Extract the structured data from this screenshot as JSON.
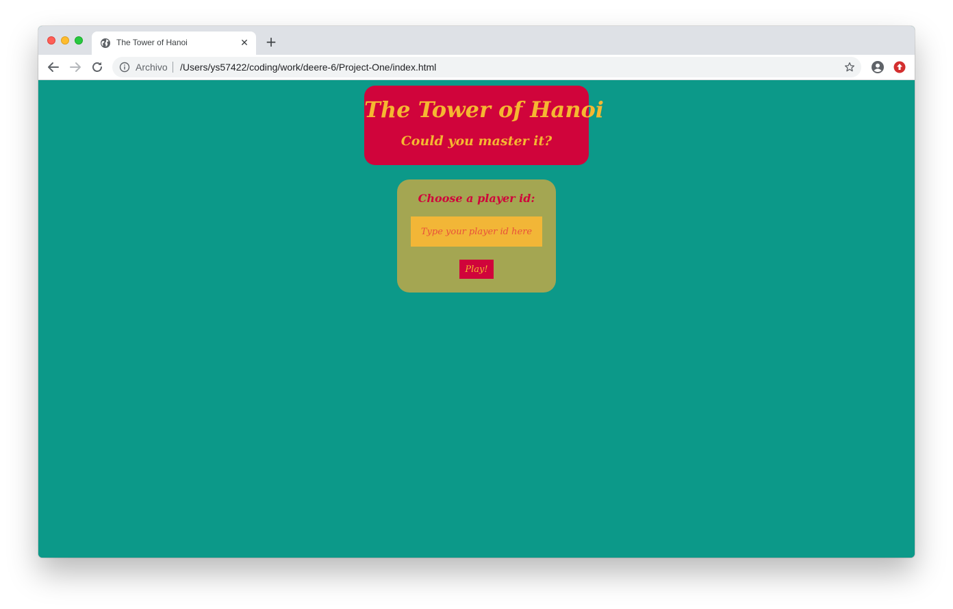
{
  "browser": {
    "tab_title": "The Tower of Hanoi",
    "tab_close_glyph": "✕",
    "new_tab_glyph": "+",
    "origin_label": "Archivo",
    "url": "/Users/ys57422/coding/work/deere-6/Project-One/index.html",
    "icons": {
      "favicon": "globe-icon",
      "back": "arrow-left-icon",
      "forward": "arrow-right-icon",
      "reload": "reload-icon",
      "info": "info-icon",
      "bookmark": "star-icon",
      "profile": "account-circle-icon",
      "extension": "red-upload-badge-icon"
    }
  },
  "page": {
    "title": "The Tower of Hanoi",
    "subtitle": "Could you master it?",
    "player_prompt": "Choose a player id:",
    "player_input_placeholder": "Type your player id here",
    "player_input_value": "",
    "play_button_label": "Play!"
  },
  "colors": {
    "background": "#0c9989",
    "header_card": "#d0043b",
    "header_text": "#f5b731",
    "player_card": "#a4a652",
    "player_label": "#d0043b",
    "input_background": "#f2b637",
    "input_placeholder": "#e8503a",
    "button_background": "#d0043b",
    "button_text": "#f5b731"
  }
}
